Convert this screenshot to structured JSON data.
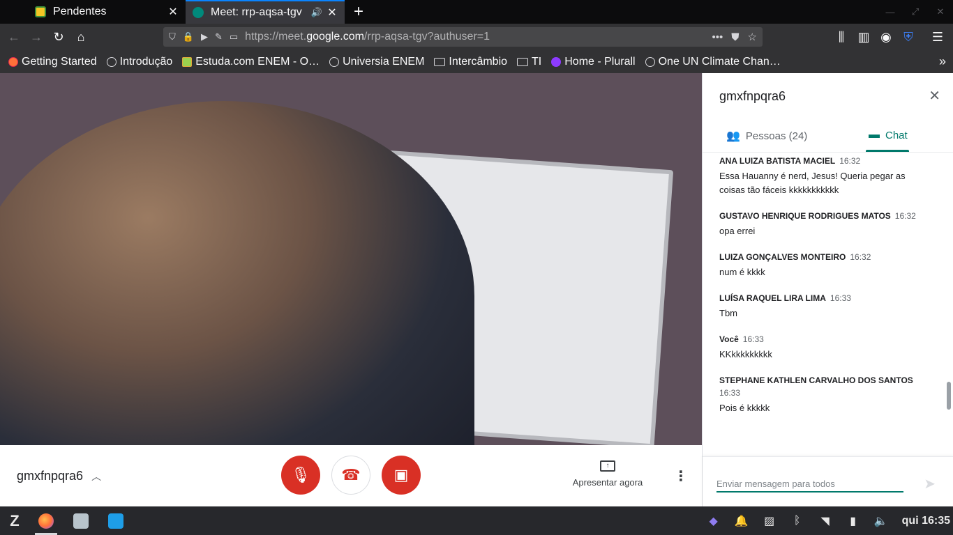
{
  "browser": {
    "tabs": [
      {
        "title": "Pendentes",
        "active": false
      },
      {
        "title": "Meet: rrp-aqsa-tgv",
        "active": true
      }
    ],
    "url_prefix": "https://meet.",
    "url_domain": "google.com",
    "url_path": "/rrp-aqsa-tgv?authuser=1",
    "bookmarks": [
      {
        "label": "Getting Started",
        "icon": "firefox-icon"
      },
      {
        "label": "Introdução",
        "icon": "globe-icon"
      },
      {
        "label": "Estuda.com ENEM - O…",
        "icon": "pencil-icon"
      },
      {
        "label": "Universia ENEM",
        "icon": "globe-icon"
      },
      {
        "label": "Intercâmbio",
        "icon": "folder-icon"
      },
      {
        "label": "TI",
        "icon": "folder-icon"
      },
      {
        "label": "Home - Plurall",
        "icon": "plurall-icon"
      },
      {
        "label": "One UN Climate Chan…",
        "icon": "globe-icon"
      }
    ]
  },
  "meeting": {
    "name": "gmxfnpqra6",
    "present_label": "Apresentar agora"
  },
  "panel": {
    "title": "gmxfnpqra6",
    "people_tab": "Pessoas (24)",
    "chat_tab": "Chat",
    "messages": [
      {
        "sender": "ANA LUIZA BATISTA MACIEL",
        "time": "16:32",
        "text": "Essa Hauanny é nerd, Jesus! Queria pegar as coisas tão fáceis kkkkkkkkkkk"
      },
      {
        "sender": "GUSTAVO HENRIQUE RODRIGUES MATOS",
        "time": "16:32",
        "text": "opa errei"
      },
      {
        "sender": "LUIZA GONÇALVES MONTEIRO",
        "time": "16:32",
        "text": "num é kkkk"
      },
      {
        "sender": "LUÍSA RAQUEL LIRA LIMA",
        "time": "16:33",
        "text": "Tbm"
      },
      {
        "sender": "Você",
        "time": "16:33",
        "text": "KKkkkkkkkkk"
      },
      {
        "sender": "STEPHANE KATHLEN CARVALHO DOS SANTOS",
        "time": "16:33",
        "text": "Pois é kkkkk"
      }
    ],
    "input_placeholder": "Enviar mensagem para todos"
  },
  "taskbar": {
    "clock": "qui 16:35"
  },
  "colors": {
    "accent": "#00796b",
    "danger": "#d93025",
    "tab_accent": "#0a84ff"
  }
}
